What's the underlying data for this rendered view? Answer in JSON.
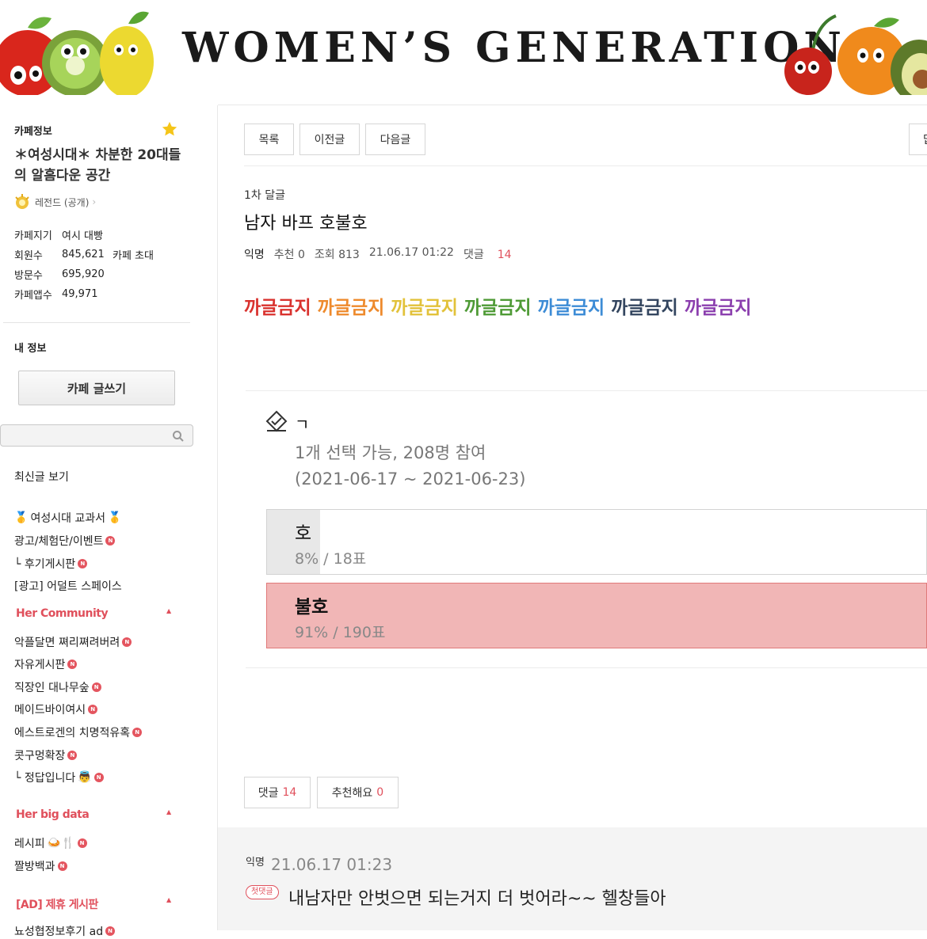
{
  "banner": {
    "title": "WOMEN’S GENERATION"
  },
  "sidebar": {
    "cafe_info_label": "카페정보",
    "cafe_description": "＊여성시대＊ 차분한 20대들의 알흠다운 공간",
    "grade": "레전드 (공개)",
    "info": [
      {
        "key": "카페지기",
        "value": "여시 대빵",
        "extra": ""
      },
      {
        "key": "회원수",
        "value": "845,621",
        "extra": "카페 초대"
      },
      {
        "key": "방문수",
        "value": "695,920",
        "extra": ""
      },
      {
        "key": "카페앱수",
        "value": "49,971",
        "extra": ""
      }
    ],
    "my_info_label": "내 정보",
    "write_button": "카페 글쓰기",
    "search_placeholder": "",
    "recent_posts": "최신글 보기",
    "menu_top": [
      {
        "label": "여성시대 교과서",
        "badge": ""
      },
      {
        "label": "광고/체험단/이벤트",
        "badge": "N"
      },
      {
        "label": "└ 후기게시판",
        "badge": "N"
      },
      {
        "label": "[광고] 어덜트 스페이스",
        "badge": ""
      }
    ],
    "section_community": "Her Community",
    "menu_community": [
      {
        "label": "악플달면 쪄리쪄려버려",
        "badge": "N"
      },
      {
        "label": "자유게시판",
        "badge": "N"
      },
      {
        "label": "직장인 대나무숲",
        "badge": "N"
      },
      {
        "label": "메이드바이여시",
        "badge": "N"
      },
      {
        "label": "에스트로겐의 치명적유혹",
        "badge": "N"
      },
      {
        "label": "콧구멍확장",
        "badge": "N"
      },
      {
        "label": "└ 정답입니다",
        "badge": "N"
      }
    ],
    "section_bigdata": "Her big data",
    "menu_bigdata": [
      {
        "label": "레시피",
        "badge": "N"
      },
      {
        "label": "짤방백과",
        "badge": "N"
      }
    ],
    "section_ad": "[AD] 제휴 게시판",
    "menu_ad": [
      {
        "label": "뇨성협정보후기 ad",
        "badge": "N"
      }
    ]
  },
  "toolbar": {
    "list": "목록",
    "prev": "이전글",
    "next": "다음글",
    "right_partial": "답"
  },
  "post": {
    "board": "1차 달글",
    "title": "남자 바프 호불호",
    "writer": "익명",
    "recommend": "추천 0",
    "views": "조회 813",
    "date": "21.06.17 01:22",
    "comments_label": "댓글",
    "comments_count": "14",
    "rainbow": [
      {
        "text": "까글금지",
        "color": "#d9322e"
      },
      {
        "text": "까글금지",
        "color": "#ee8a2c"
      },
      {
        "text": "까글금지",
        "color": "#e2c23a"
      },
      {
        "text": "까글금지",
        "color": "#4e9a35"
      },
      {
        "text": "까글금지",
        "color": "#3d8cd6"
      },
      {
        "text": "까글금지",
        "color": "#33455f"
      },
      {
        "text": "까글금지",
        "color": "#8b3fae"
      }
    ]
  },
  "poll": {
    "title": "ㄱ",
    "info": "1개 선택 가능, 208명 참여",
    "period": "(2021-06-17 ~ 2021-06-23)",
    "options": [
      {
        "label": "호",
        "result": "8% / 18표",
        "ratio": 0.08,
        "fill": "#e8e8e8",
        "border": "#d3d3d3"
      },
      {
        "label": "불호",
        "result": "91% / 190표",
        "ratio": 1.0,
        "fill": "#f1b6b6",
        "border": "#e07a7a"
      }
    ]
  },
  "actions": {
    "comment_label": "댓글",
    "comment_count": "14",
    "recommend_label": "추천해요",
    "recommend_count": "0"
  },
  "comment": {
    "writer": "익명",
    "date": "21.06.17 01:23",
    "badge": "첫댓글",
    "text": "내남자만 안벗으면 되는거지 더 벗어라~~ 헬창들아"
  }
}
